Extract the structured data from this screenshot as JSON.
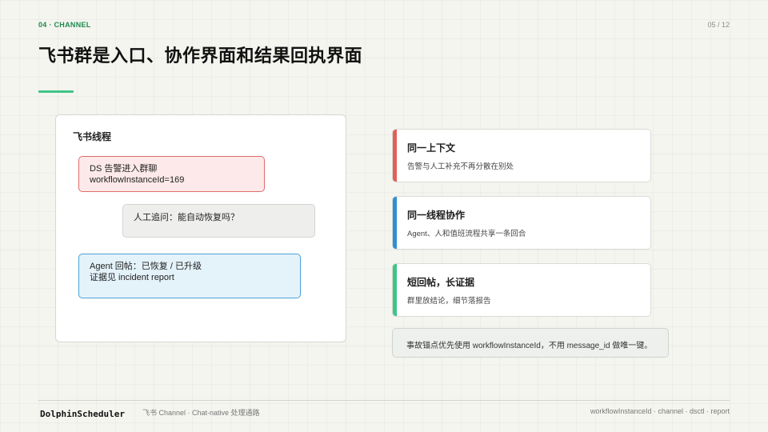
{
  "header": {
    "section_tag": "04 · CHANNEL",
    "page_number": "05 / 12",
    "title": "飞书群是入口、协作界面和结果回执界面"
  },
  "thread_panel": {
    "title": "飞书线程",
    "messages": [
      {
        "line1": "DS 告警进入群聊",
        "line2": "workflowInstanceId=169"
      },
      {
        "line1": "人工追问：能自动恢复吗？"
      },
      {
        "line1": "Agent 回帖：已恢复 / 已升级",
        "line2": "证据见 incident report"
      }
    ]
  },
  "cards": [
    {
      "title": "同一上下文",
      "desc": "告警与人工补充不再分散在别处",
      "accent": "#e0605a"
    },
    {
      "title": "同一线程协作",
      "desc": "Agent、人和值班流程共享一条回合",
      "accent": "#2f8fcf"
    },
    {
      "title": "短回帖，长证据",
      "desc": "群里放结论，细节落报告",
      "accent": "#3fc488"
    }
  ],
  "note": "事故锚点优先使用 workflowInstanceId，不用 message_id 做唯一键。",
  "footer": {
    "logo": "DolphinScheduler",
    "left_text": "飞书 Channel · Chat-native 处理通路",
    "right_text": "workflowInstanceId · channel · dsctl · report"
  },
  "colors": {
    "accent_green": "#3fc488",
    "section_green": "#1f8a4c",
    "alert_red": "#e06c6c",
    "agent_blue": "#4ba3d6"
  }
}
